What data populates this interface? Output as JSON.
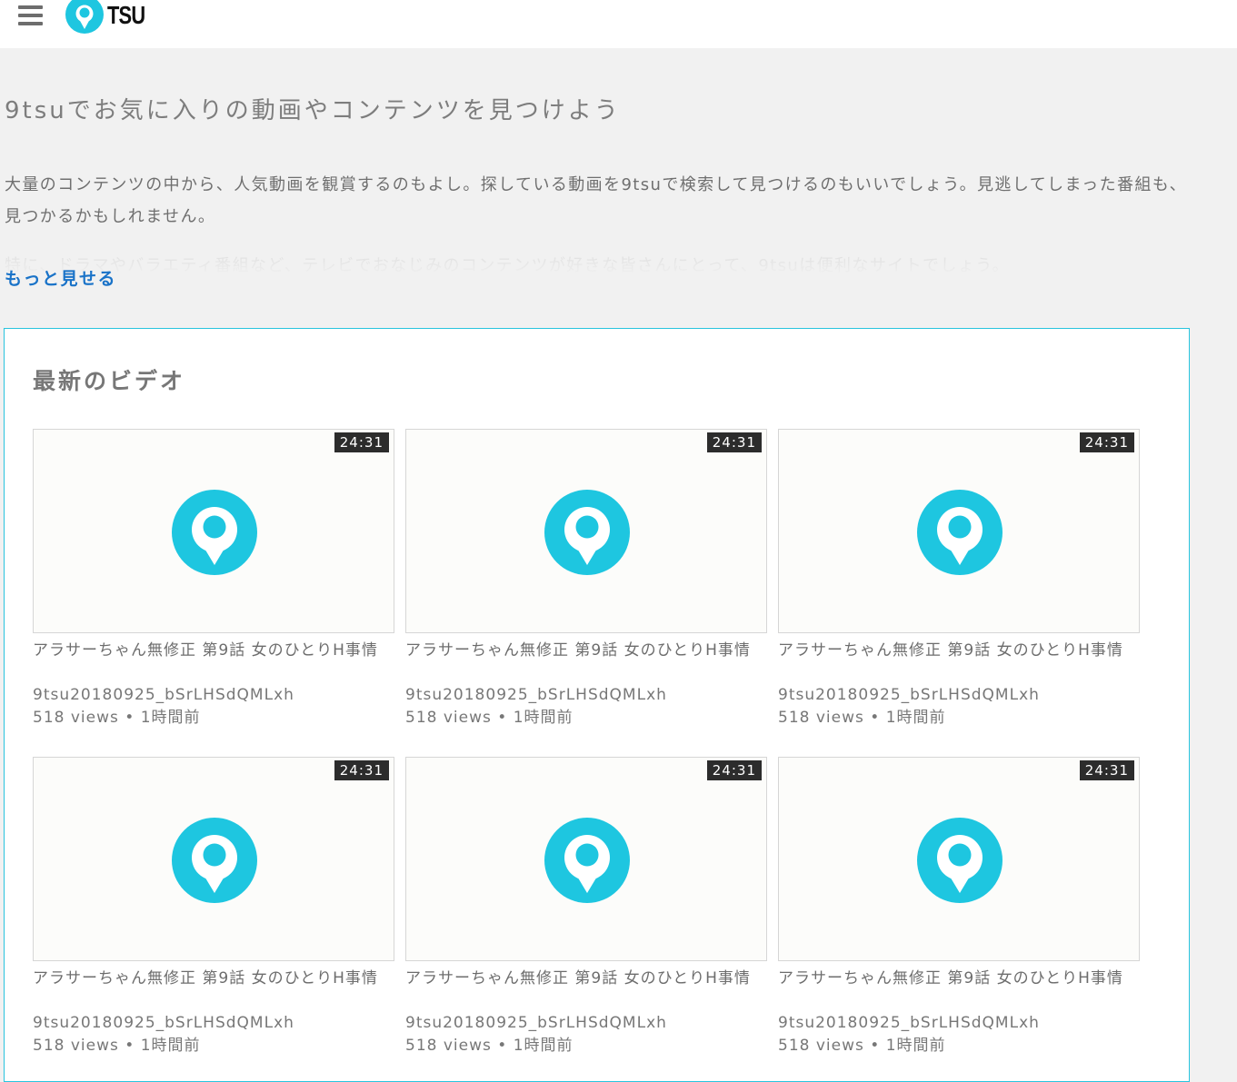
{
  "header": {
    "menu_icon": "hamburger-menu-icon",
    "logo_text": "TSU",
    "logo_icon": "9tsu-pin-logo-icon",
    "brand_color": "#1ec6e0"
  },
  "hero": {
    "title": "9tsuでお気に入りの動画やコンテンツを見つけよう",
    "description": "大量のコンテンツの中から、人気動画を観賞するのもよし。探している動画を9tsuで検索して見つけるのもいいでしょう。見逃してしまった番組も、見つかるかもしれません。",
    "faded_text": "特に、ドラマやバラエティ番組など、テレビでおなじみのコンテンツが好きな皆さんにとって、9tsuは便利なサイトでしょう。",
    "more_link": "もっと見せる"
  },
  "latest": {
    "title": "最新のビデオ",
    "videos": [
      {
        "duration": "24:31",
        "title": "アラサーちゃん無修正 第9話 女のひとりH事情",
        "id": "9tsu20180925_bSrLHSdQMLxh",
        "meta": "518 views • 1時間前"
      },
      {
        "duration": "24:31",
        "title": "アラサーちゃん無修正 第9話 女のひとりH事情",
        "id": "9tsu20180925_bSrLHSdQMLxh",
        "meta": "518 views • 1時間前"
      },
      {
        "duration": "24:31",
        "title": "アラサーちゃん無修正 第9話 女のひとりH事情",
        "id": "9tsu20180925_bSrLHSdQMLxh",
        "meta": "518 views • 1時間前"
      },
      {
        "duration": "24:31",
        "title": "アラサーちゃん無修正 第9話 女のひとりH事情",
        "id": "9tsu20180925_bSrLHSdQMLxh",
        "meta": "518 views • 1時間前"
      },
      {
        "duration": "24:31",
        "title": "アラサーちゃん無修正 第9話 女のひとりH事情",
        "id": "9tsu20180925_bSrLHSdQMLxh",
        "meta": "518 views • 1時間前"
      },
      {
        "duration": "24:31",
        "title": "アラサーちゃん無修正 第9話 女のひとりH事情",
        "id": "9tsu20180925_bSrLHSdQMLxh",
        "meta": "518 views • 1時間前"
      }
    ]
  }
}
